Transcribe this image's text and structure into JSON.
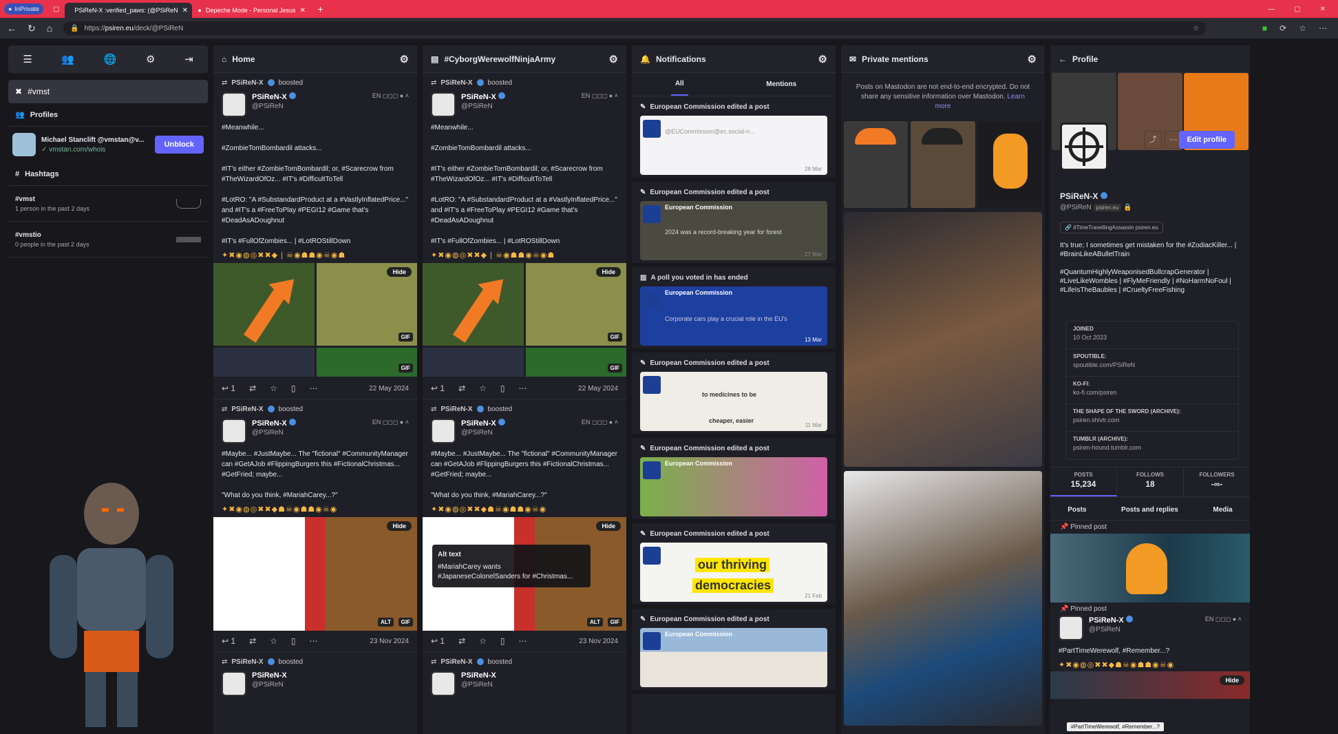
{
  "browser": {
    "inprivate": "InPrivate",
    "tabs": [
      {
        "title": "PSiReN-X :verified_paws: (@PSiReN"
      },
      {
        "title": "Depeche Mode - Personal Jesus"
      }
    ],
    "url_prefix": "https://",
    "url_host": "psiren.eu",
    "url_path": "/deck/@PSiReN"
  },
  "sidebar": {
    "search_term": "#vmst",
    "profiles_heading": "Profiles",
    "profile": {
      "name": "Michael Stanclift @vmstan@v...",
      "link": "vmstan.com/whois",
      "action": "Unblock"
    },
    "hashtags_heading": "Hashtags",
    "hashtags": [
      {
        "tag": "#vmst",
        "stat": "1 person in the past 2 days"
      },
      {
        "tag": "#vmstio",
        "stat": "0 people in the past 2 days"
      }
    ]
  },
  "columns": {
    "home": {
      "title": "Home"
    },
    "cyborg": {
      "title": "#CyborgWerewolfNinjaArmy"
    },
    "notifications": {
      "title": "Notifications",
      "tab_all": "All",
      "tab_mentions": "Mentions"
    },
    "private": {
      "title": "Private mentions",
      "note": "Posts on Mastodon are not end-to-end encrypted. Do not share any sensitive information over Mastodon.",
      "learn_more": "Learn more"
    },
    "profile": {
      "title": "Profile"
    }
  },
  "post1": {
    "booster": "PSiReN-X",
    "boosted": "boosted",
    "name": "PSiReN-X",
    "handle": "@PSiReN",
    "lang": "EN",
    "body": "#Meanwhile...\n\n#ZombieTomBombardil attacks...\n\n#IT's either #ZombieTomBombardil; or, #Scarecrow from #TheWizardOfOz... #IT's #DifficultToTell\n\n#LotRO: \"A #SubstandardProduct at a #VastlyInflatedPrice...\" and #IT's a #FreeToPlay #PEGI12 #Game that's #DeadAsADoughnut\n\n#IT's #FullOfZombies... | #LotROStillDown",
    "hide": "Hide",
    "gif": "GIF",
    "replies": "1",
    "date": "22 May 2024"
  },
  "post2": {
    "booster": "PSiReN-X",
    "boosted": "boosted",
    "name": "PSiReN-X",
    "handle": "@PSiReN",
    "lang": "EN",
    "body": "#Maybe... #JustMaybe... The \"fictional\" #CommunityManager can #GetAJob #FlippingBurgers this #FictionalChristmas... #GetFried; maybe...\n\n\"What do you think, #MariahCarey...?\"",
    "hide": "Hide",
    "alt": "ALT",
    "gif": "GIF",
    "replies": "1",
    "date": "23 Nov 2024",
    "alt_title": "Alt text",
    "alt_text": "#MariahCarey wants #JapaneseColonelSanders for #Christmas..."
  },
  "post3": {
    "booster": "PSiReN-X",
    "boosted": "boosted",
    "name": "PSiReN-X",
    "handle": "@PSiReN",
    "lang": "EN"
  },
  "notifications": [
    {
      "head": "European Commission edited a post",
      "name": "European Commission",
      "date": "28 Mar"
    },
    {
      "head": "European Commission edited a post",
      "name": "European Commission",
      "date": "27 Mar"
    },
    {
      "head": "A poll you voted in has ended",
      "name": "European Commission",
      "date": "13 Mar"
    },
    {
      "head": "European Commission edited a post",
      "name": "European Commission",
      "date": "11 Mar"
    },
    {
      "head": "European Commission edited a post",
      "name": "European Commission",
      "date": ""
    },
    {
      "head": "European Commission edited a post",
      "name": "European Commission",
      "date": "21 Feb"
    },
    {
      "head": "European Commission edited a post",
      "name": "European Commission",
      "date": ""
    }
  ],
  "notif_extra": {
    "poll_text": "Corporate cars play a crucial role in the EU's",
    "handle": "@EUCommission@ec.social-n...",
    "thriving": "our thriving",
    "democracies": "democracies",
    "medicines": "to medicines to be",
    "cheaper": "cheaper, easier",
    "record": "2024 was a record-breaking year for forest"
  },
  "profile": {
    "name": "PSiReN-X",
    "handle": "@PSiReN",
    "domain_chip": "psiren.eu",
    "edit": "Edit profile",
    "tag_chip": "#TimeTravellingAssassin psiren.eu",
    "bio": "It's true; I sometimes get mistaken for the #ZodiacKiller... | #BrainLikeABulletTrain\n\n#QuantumHighlyWeaponisedBullcrapGenerator | #LiveLikeWombles | #FlyMeFriendly | #NoHarmNoFoul | #LifeIsTheBaubles | #CrueltyFreeFishing",
    "fields": [
      {
        "k": "JOINED",
        "v": "10 Oct 2023"
      },
      {
        "k": "SPOUTIBLE:",
        "v": "spoutible.com/PSiReN"
      },
      {
        "k": "KO-FI:",
        "v": "ko-fi.com/psiren"
      },
      {
        "k": "THE SHAPE OF THE SWORD (ARCHIVE):",
        "v": "psiren.shivtr.com"
      },
      {
        "k": "TUMBLR (ARCHIVE):",
        "v": "psiren-hound.tumblr.com"
      }
    ],
    "stats": [
      {
        "k": "POSTS",
        "v": "15,234"
      },
      {
        "k": "FOLLOWS",
        "v": "18"
      },
      {
        "k": "FOLLOWERS",
        "v": "-∞-"
      }
    ],
    "tabs": [
      "Posts",
      "Posts and replies",
      "Media"
    ],
    "pinned": "Pinned post",
    "pinned_post_name": "PSiReN-X",
    "pinned_post_handle": "@PSiReN",
    "pinned_post_body": "#PartTimeWerewolf, #Remember...?",
    "hide": "Hide",
    "tooltip": "#PartTimeWerewolf, #Remember...?"
  }
}
